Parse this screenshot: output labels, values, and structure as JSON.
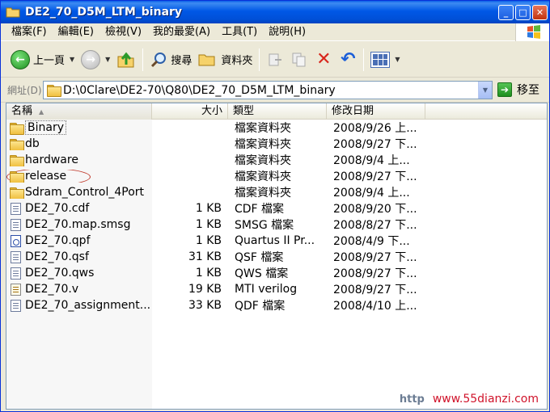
{
  "window": {
    "title": "DE2_70_D5M_LTM_binary",
    "controls": [
      "_",
      "□",
      "✕"
    ]
  },
  "menu": [
    {
      "label": "檔案(F)"
    },
    {
      "label": "編輯(E)"
    },
    {
      "label": "檢視(V)"
    },
    {
      "label": "我的最愛(A)"
    },
    {
      "label": "工具(T)"
    },
    {
      "label": "說明(H)"
    }
  ],
  "toolbar": {
    "back_label": "上一頁",
    "search_label": "搜尋",
    "folders_label": "資料夾"
  },
  "address": {
    "label": "網址(D)",
    "path": "D:\\0Clare\\DE2-70\\Q80\\DE2_70_D5M_LTM_binary",
    "go_label": "移至"
  },
  "columns": {
    "name": "名稱",
    "size": "大小",
    "type": "類型",
    "date": "修改日期"
  },
  "files": [
    {
      "name": "Binary",
      "size": "",
      "type": "檔案資料夾",
      "date": "2008/9/26 上...",
      "icon": "folder-icon"
    },
    {
      "name": "db",
      "size": "",
      "type": "檔案資料夾",
      "date": "2008/9/27 下...",
      "icon": "folder-icon"
    },
    {
      "name": "hardware",
      "size": "",
      "type": "檔案資料夾",
      "date": "2008/9/4 上...",
      "icon": "folder-icon"
    },
    {
      "name": "release",
      "size": "",
      "type": "檔案資料夾",
      "date": "2008/9/27 下...",
      "icon": "folder-icon"
    },
    {
      "name": "Sdram_Control_4Port",
      "size": "",
      "type": "檔案資料夾",
      "date": "2008/9/4 上...",
      "icon": "folder-icon"
    },
    {
      "name": "DE2_70.cdf",
      "size": "1 KB",
      "type": "CDF 檔案",
      "date": "2008/9/20 下...",
      "icon": "file-icon"
    },
    {
      "name": "DE2_70.map.smsg",
      "size": "1 KB",
      "type": "SMSG 檔案",
      "date": "2008/8/27 下...",
      "icon": "file-icon"
    },
    {
      "name": "DE2_70.qpf",
      "size": "1 KB",
      "type": "Quartus II Pr...",
      "date": "2008/4/9 下...",
      "icon": "quartus-project-icon"
    },
    {
      "name": "DE2_70.qsf",
      "size": "31 KB",
      "type": "QSF 檔案",
      "date": "2008/9/27 下...",
      "icon": "file-icon"
    },
    {
      "name": "DE2_70.qws",
      "size": "1 KB",
      "type": "QWS 檔案",
      "date": "2008/9/27 下...",
      "icon": "file-icon"
    },
    {
      "name": "DE2_70.v",
      "size": "19 KB",
      "type": "MTI verilog",
      "date": "2008/9/27 下...",
      "icon": "verilog-file-icon"
    },
    {
      "name": "DE2_70_assignment...",
      "size": "33 KB",
      "type": "QDF 檔案",
      "date": "2008/4/10 上...",
      "icon": "file-icon"
    }
  ],
  "watermark": {
    "http": "http",
    "site": "www.55dianzi.com"
  }
}
